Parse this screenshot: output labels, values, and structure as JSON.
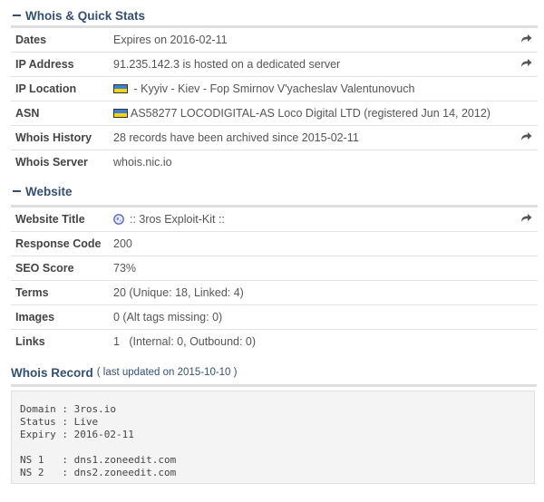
{
  "whois_section": {
    "title": "Whois & Quick Stats",
    "rows": [
      {
        "label": "Dates",
        "value": "Expires on 2016-02-11",
        "action_icon": "share-icon"
      },
      {
        "label": "IP Address",
        "value": "91.235.142.3 is hosted on a dedicated server",
        "action_icon": "share-icon"
      },
      {
        "label": "IP Location",
        "value": " - Kyyiv - Kiev - Fop Smirnov V'yacheslav Valentunovuch",
        "flag": "ukraine-flag-icon"
      },
      {
        "label": "ASN",
        "value": "AS58277 LOCODIGITAL-AS Loco Digital LTD (registered Jun 14, 2012)",
        "flag": "ukraine-flag-icon"
      },
      {
        "label": "Whois History",
        "value": "28 records have been archived since 2015-02-11",
        "action_icon": "share-icon"
      },
      {
        "label": "Whois Server",
        "value": "whois.nic.io"
      }
    ]
  },
  "website_section": {
    "title": "Website",
    "rows": [
      {
        "label": "Website Title",
        "value": ":: 3ros Exploit-Kit ::",
        "icon": "globe-icon",
        "action_icon": "share-icon"
      },
      {
        "label": "Response Code",
        "value": "200"
      },
      {
        "label": "SEO Score",
        "value": "73%"
      },
      {
        "label": "Terms",
        "value": "20 (Unique: 18, Linked: 4)"
      },
      {
        "label": "Images",
        "value": "0 (Alt tags missing: 0)"
      },
      {
        "label": "Links",
        "value": "1   (Internal: 0, Outbound: 0)"
      }
    ]
  },
  "whois_record": {
    "title": "Whois Record",
    "subtitle": "( last updated on 2015-10-10 )",
    "lines": [
      "Domain : 3ros.io",
      "Status : Live",
      "Expiry : 2016-02-11",
      "",
      "NS 1   : dns1.zoneedit.com",
      "NS 2   : dns2.zoneedit.com"
    ]
  },
  "colors": {
    "heading": "#34506e",
    "share_icon": "#555555",
    "record_bg": "#f4f4f4"
  }
}
